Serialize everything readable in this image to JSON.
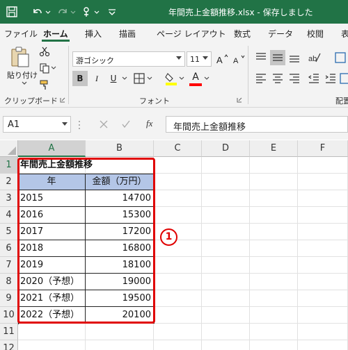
{
  "window": {
    "title": "年間売上金額推移.xlsx  -  保存しました"
  },
  "ribbon_tabs": [
    "ファイル",
    "ホーム",
    "挿入",
    "描画",
    "ページ レイアウト",
    "数式",
    "データ",
    "校閲",
    "表"
  ],
  "active_tab": "ホーム",
  "clipboard": {
    "paste_label": "貼り付け",
    "group_label": "クリップボード"
  },
  "font_group": {
    "font_name": "游ゴシック",
    "font_size": "11",
    "bold": "B",
    "italic": "I",
    "underline": "U",
    "font_color_glyph": "A",
    "group_label": "フォント",
    "colors": {
      "fill": "#ffff00",
      "font": "#ff0000"
    }
  },
  "alignment_group": {
    "group_label": "配置"
  },
  "formula_bar": {
    "name_box": "A1",
    "fx_label": "fx",
    "content": "年間売上金額推移"
  },
  "sheet": {
    "columns": [
      "A",
      "B",
      "C",
      "D",
      "E",
      "F"
    ],
    "rows": [
      "1",
      "2",
      "3",
      "4",
      "5",
      "6",
      "7",
      "8",
      "9",
      "10",
      "11",
      "12"
    ],
    "title_cell": "年間売上金額推移",
    "header": [
      "年",
      "金額（万円）"
    ],
    "data": [
      [
        "2015",
        "14700"
      ],
      [
        "2016",
        "15300"
      ],
      [
        "2017",
        "17200"
      ],
      [
        "2018",
        "16800"
      ],
      [
        "2019",
        "18100"
      ],
      [
        "2020（予想）",
        "19000"
      ],
      [
        "2021（予想）",
        "19500"
      ],
      [
        "2022（予想）",
        "20100"
      ]
    ]
  },
  "annotation": {
    "marker": "1"
  },
  "colors": {
    "excel_green": "#217346",
    "header_fill": "#b4c6e7",
    "highlight": "#e00000"
  }
}
